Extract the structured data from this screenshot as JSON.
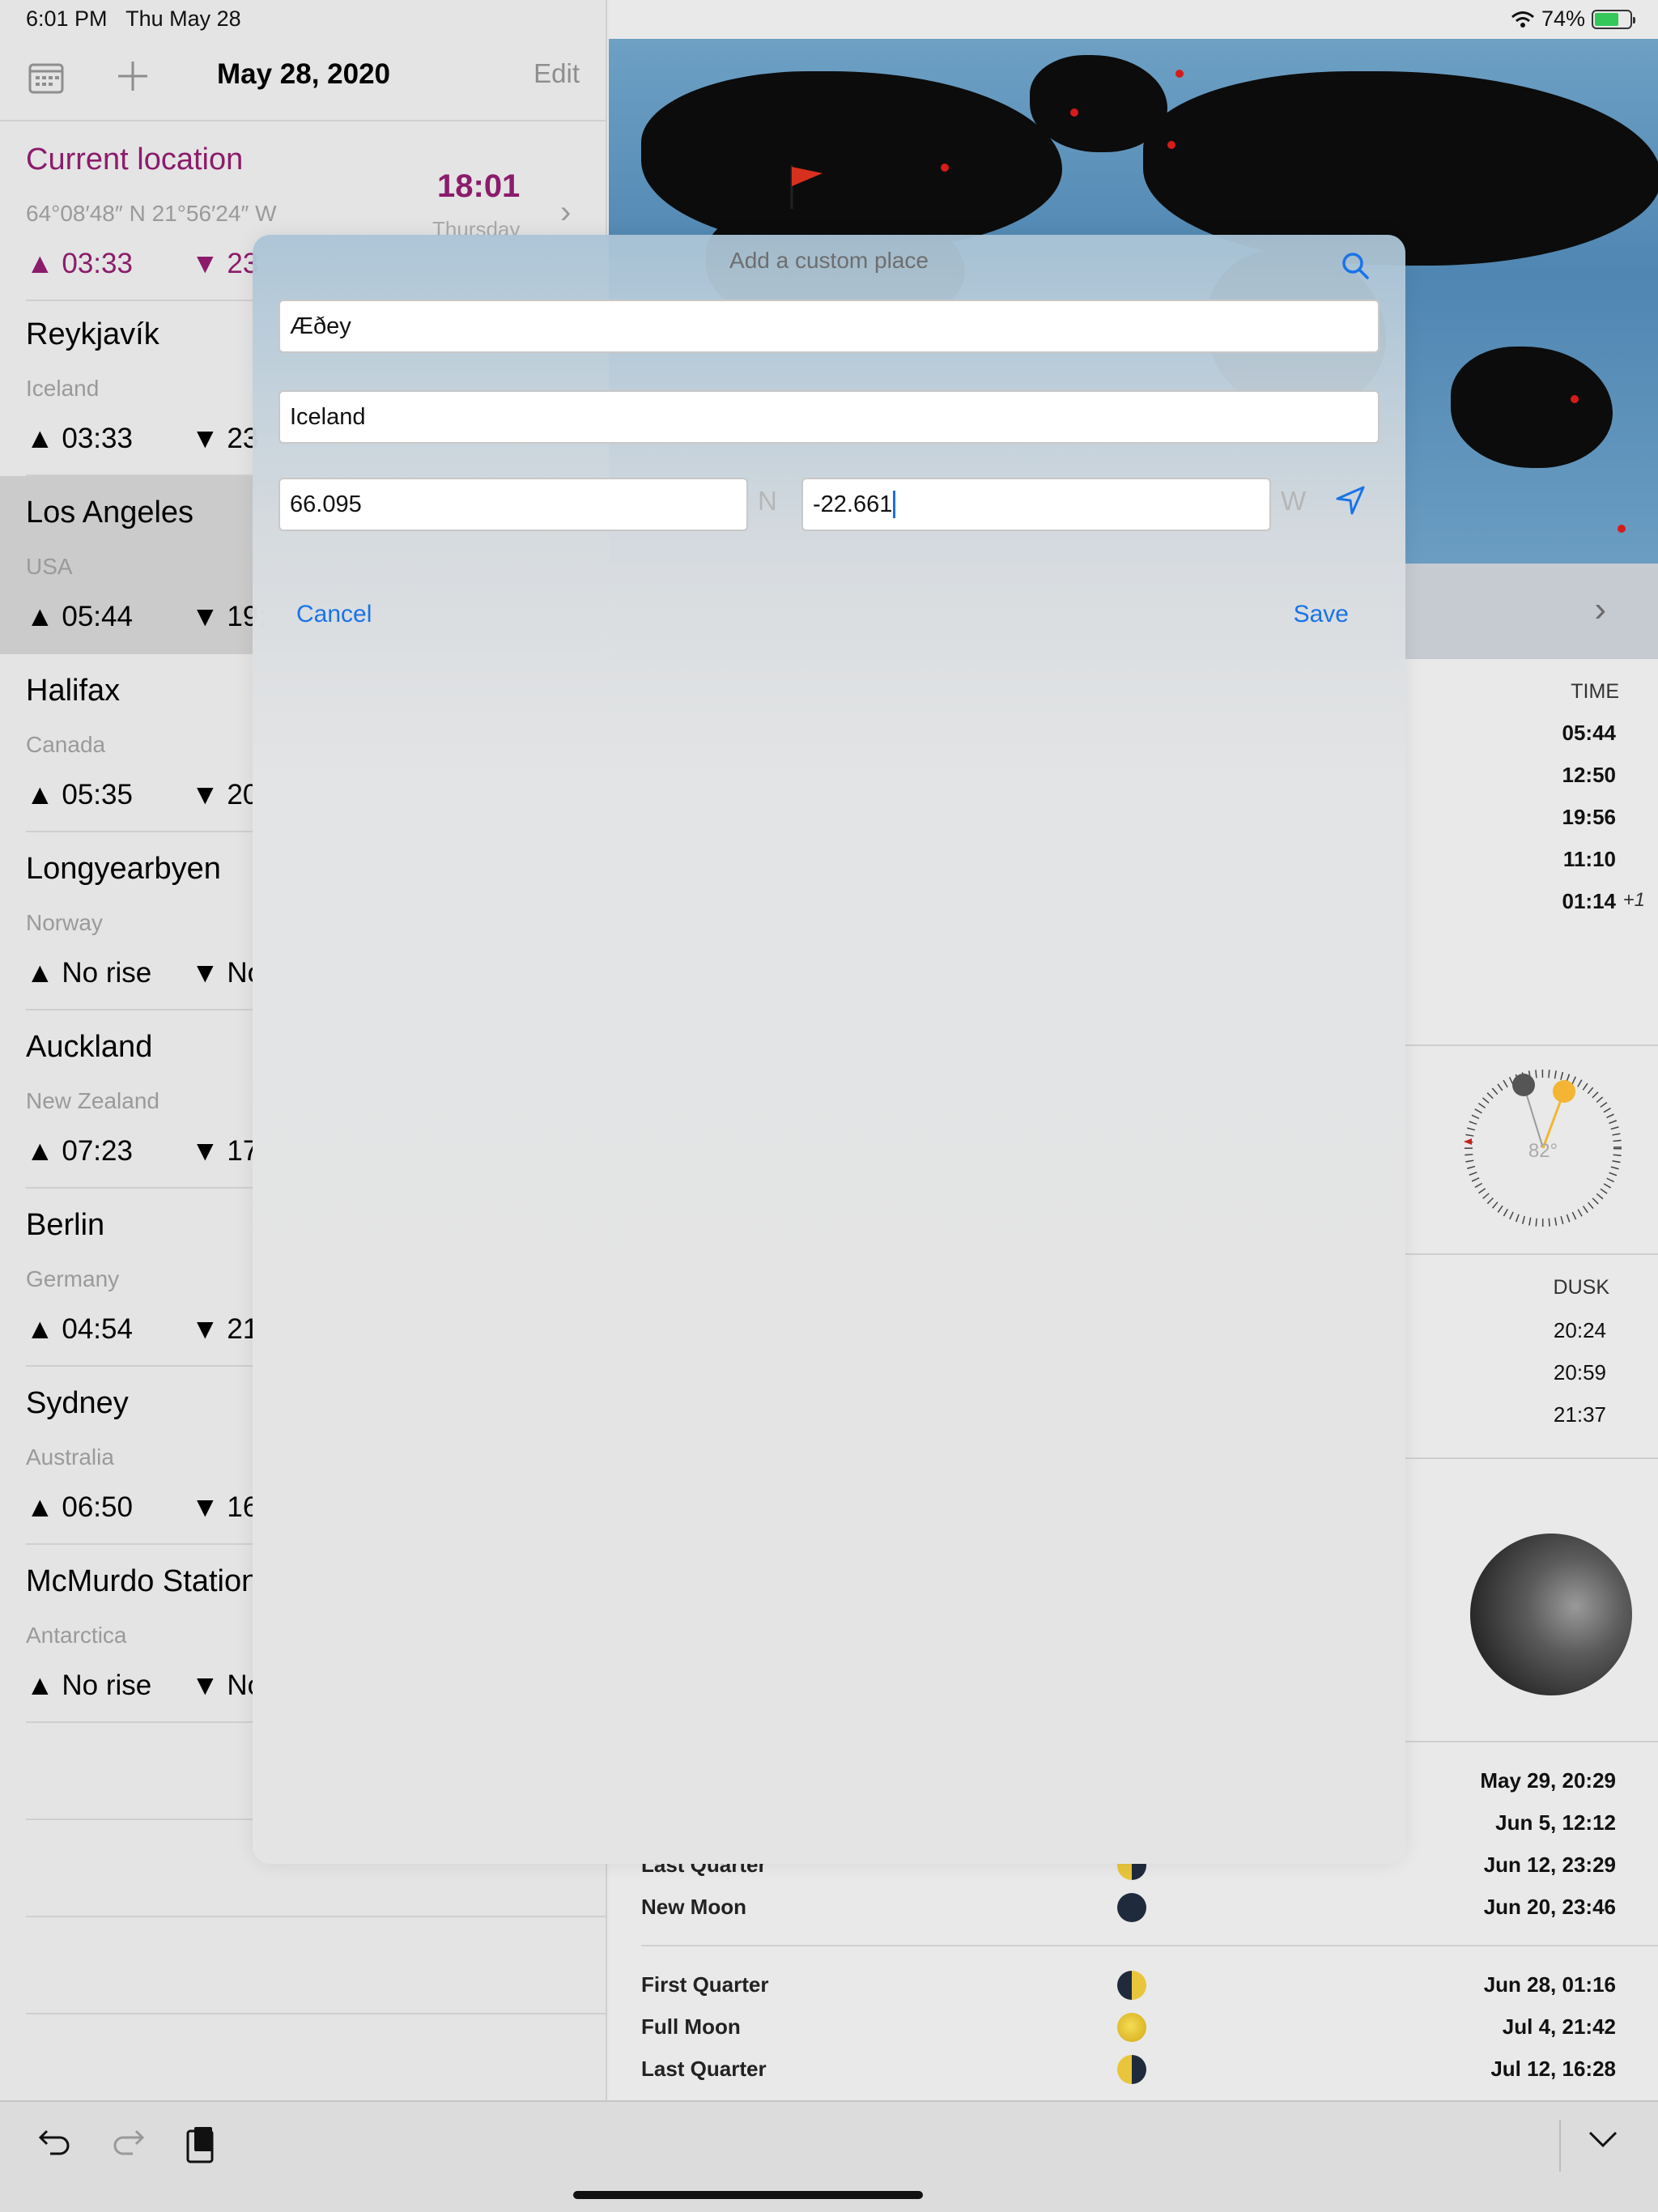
{
  "status_bar": {
    "time": "6:01 PM",
    "date": "Thu May 28",
    "battery": "74%",
    "battery_level": 0.74
  },
  "sidebar": {
    "date": "May 28, 2020",
    "edit_label": "Edit",
    "current": {
      "name": "Current location",
      "coords": "64°08′48″ N 21°56′24″ W",
      "rise": "▲ 03:33",
      "set": "▼ 23",
      "time": "18:01",
      "day": "Thursday"
    },
    "locations": [
      {
        "name": "Reykjavík",
        "country": "Iceland",
        "rise": "▲ 03:33",
        "set": "▼ 23"
      },
      {
        "name": "Los Angeles",
        "country": "USA",
        "rise": "▲ 05:44",
        "set": "▼ 19:"
      },
      {
        "name": "Halifax",
        "country": "Canada",
        "rise": "▲ 05:35",
        "set": "▼ 20"
      },
      {
        "name": "Longyearbyen",
        "country": "Norway",
        "rise": "▲ No rise",
        "set": "▼ No"
      },
      {
        "name": "Auckland",
        "country": "New Zealand",
        "rise": "▲ 07:23",
        "set": "▼ 17:"
      },
      {
        "name": "Berlin",
        "country": "Germany",
        "rise": "▲ 04:54",
        "set": "▼ 21:"
      },
      {
        "name": "Sydney",
        "country": "Australia",
        "rise": "▲ 06:50",
        "set": "▼ 16:"
      },
      {
        "name": "McMurdo Station",
        "country": "Antarctica",
        "rise": "▲ No rise",
        "set": "▼ No"
      }
    ]
  },
  "detail": {
    "time_head": "TIME",
    "times": [
      "05:44",
      "12:50",
      "19:56",
      "11:10",
      "01:14"
    ],
    "time_note": "+1",
    "compass_angle": "82°",
    "dusk_head": "DUSK",
    "dusk": [
      "20:24",
      "20:59",
      "21:37"
    ],
    "phase_dates_top": [
      "May 29, 20:29",
      "Jun 5, 12:12"
    ],
    "phases_a": [
      {
        "name": "Last Quarter",
        "date": "Jun 12, 23:29",
        "kind": "lq"
      },
      {
        "name": "New Moon",
        "date": "Jun 20, 23:46",
        "kind": "new"
      }
    ],
    "phases_b": [
      {
        "name": "First Quarter",
        "date": "Jun 28, 01:16",
        "kind": "fq"
      },
      {
        "name": "Full Moon",
        "date": "Jul 4, 21:42",
        "kind": "full"
      },
      {
        "name": "Last Quarter",
        "date": "Jul 12, 16:28",
        "kind": "lq"
      }
    ]
  },
  "modal": {
    "title": "Add a custom place",
    "name_value": "Æðey",
    "country_value": "Iceland",
    "latitude_value": "66.095",
    "latitude_hemisphere": "N",
    "longitude_value": "-22.661",
    "longitude_hemisphere": "W",
    "cancel_label": "Cancel",
    "save_label": "Save"
  },
  "colors": {
    "accent": "#1a73e8",
    "current_location": "#8b1c6b"
  }
}
